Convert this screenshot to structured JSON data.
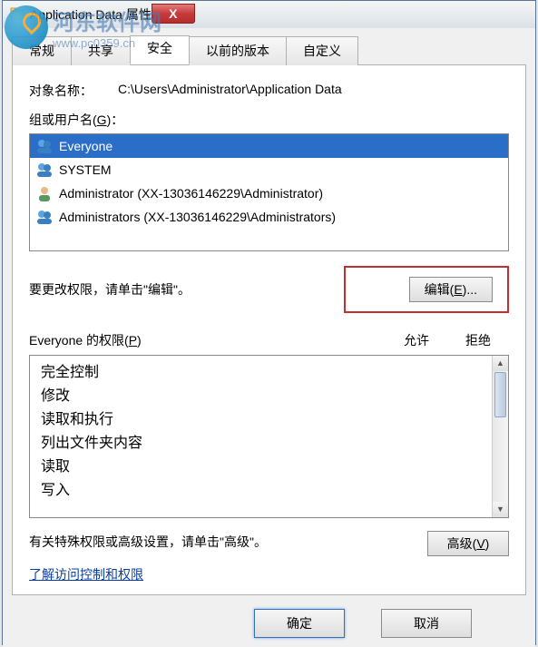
{
  "watermark": {
    "line1": "河东软件网",
    "line2": "www.pc0359.cn"
  },
  "titlebar": {
    "text": "Application Data 属性",
    "close": "X"
  },
  "tabs": {
    "general": "常规",
    "sharing": "共享",
    "security": "安全",
    "prev_versions": "以前的版本",
    "customize": "自定义"
  },
  "object": {
    "label": "对象名称：",
    "path": "C:\\Users\\Administrator\\Application Data"
  },
  "groups": {
    "label": "组或用户名(",
    "hotkey": "G",
    "label_end": ")：",
    "items": [
      {
        "name": "Everyone",
        "icon": "group"
      },
      {
        "name": "SYSTEM",
        "icon": "group"
      },
      {
        "name": "Administrator (XX-13036146229\\Administrator)",
        "icon": "single"
      },
      {
        "name": "Administrators (XX-13036146229\\Administrators)",
        "icon": "group"
      }
    ]
  },
  "edit": {
    "text": "要更改权限，请单击\"编辑\"。",
    "button": "编辑(",
    "hotkey": "E",
    "button_end": ")..."
  },
  "permissions": {
    "label_pre": "Everyone 的权限(",
    "hotkey": "P",
    "label_end": ")",
    "allow": "允许",
    "deny": "拒绝",
    "items": [
      "完全控制",
      "修改",
      "读取和执行",
      "列出文件夹内容",
      "读取",
      "写入"
    ]
  },
  "advanced": {
    "text": "有关特殊权限或高级设置，请单击\"高级\"。",
    "button": "高级(",
    "hotkey": "V",
    "button_end": ")"
  },
  "link": "了解访问控制和权限",
  "footer": {
    "ok": "确定",
    "cancel": "取消"
  }
}
